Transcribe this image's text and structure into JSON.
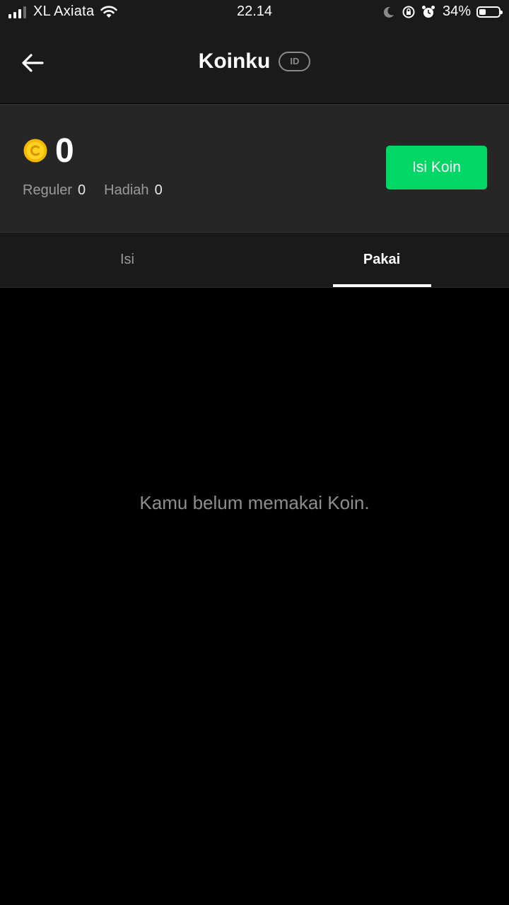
{
  "status_bar": {
    "carrier": "XL Axiata",
    "time": "22.14",
    "battery_percent": "34%",
    "battery_level": 0.34,
    "icons": [
      "signal-icon",
      "wifi-icon",
      "moon-icon",
      "rotation-lock-icon",
      "alarm-icon",
      "battery-icon"
    ]
  },
  "header": {
    "title": "Koinku",
    "badge": "ID"
  },
  "balance": {
    "total": "0",
    "regular_label": "Reguler",
    "regular_value": "0",
    "bonus_label": "Hadiah",
    "bonus_value": "0",
    "topup_label": "Isi Koin",
    "topup_color": "#00d765",
    "coin_color": "#f5b800"
  },
  "tabs": [
    {
      "label": "Isi",
      "active": false
    },
    {
      "label": "Pakai",
      "active": true
    }
  ],
  "empty_state": {
    "message": "Kamu belum memakai Koin."
  }
}
